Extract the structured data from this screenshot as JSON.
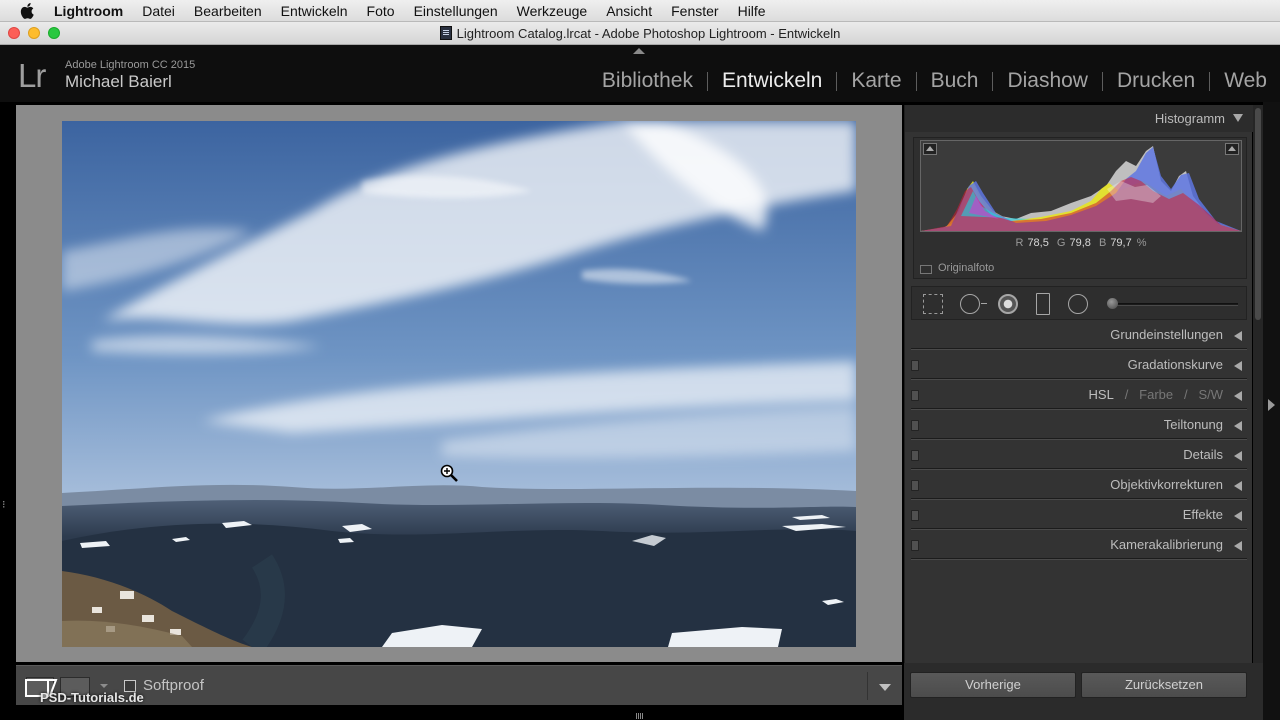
{
  "menubar": {
    "app": "Lightroom",
    "items": [
      "Datei",
      "Bearbeiten",
      "Entwickeln",
      "Foto",
      "Einstellungen",
      "Werkzeuge",
      "Ansicht",
      "Fenster",
      "Hilfe"
    ]
  },
  "window": {
    "title": "Lightroom Catalog.lrcat - Adobe Photoshop Lightroom - Entwickeln"
  },
  "identity": {
    "logo": "Lr",
    "product": "Adobe Lightroom CC 2015",
    "user": "Michael Baierl"
  },
  "modules": [
    "Bibliothek",
    "Entwickeln",
    "Karte",
    "Buch",
    "Diashow",
    "Drucken",
    "Web"
  ],
  "active_module": "Entwickeln",
  "histogram": {
    "title": "Histogramm",
    "readout": {
      "r_label": "R",
      "r": "78,5",
      "g_label": "G",
      "g": "79,8",
      "b_label": "B",
      "b": "79,7",
      "unit": "%"
    },
    "original_label": "Originalfoto"
  },
  "panels": {
    "grundeinstellungen": "Grundeinstellungen",
    "gradationskurve": "Gradationskurve",
    "hsl": "HSL",
    "sep1": "/",
    "farbe": "Farbe",
    "sep2": "/",
    "sw": "S/W",
    "teiltonung": "Teiltonung",
    "details": "Details",
    "objektivkorrekturen": "Objektivkorrekturen",
    "effekte": "Effekte",
    "kamerakalibrierung": "Kamerakalibrierung"
  },
  "toolbar": {
    "softproof_label": "Softproof"
  },
  "buttons": {
    "previous": "Vorherige",
    "reset": "Zurücksetzen"
  },
  "watermark": "PSD-Tutorials.de",
  "colors": {
    "panel_bg": "#333333",
    "canvas_gray": "#8b8b8b",
    "active_module": "#ececec"
  }
}
